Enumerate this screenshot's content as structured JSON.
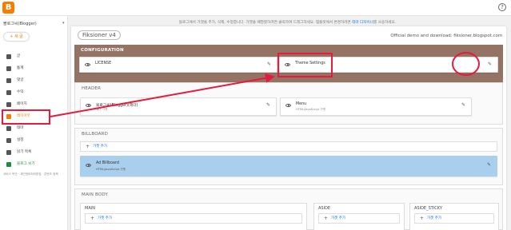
{
  "app": {
    "logo_letter": "B",
    "help_icon": "help-icon"
  },
  "notice": {
    "text": "블로그에서 가젯을 추가, 삭제, 수정합니다. 가젯을 배열할하려면 클릭하여 드래그하세요. 템플릿에서 변경하려면",
    "link": "테마 디자이너",
    "text_after": "를 사용하세요."
  },
  "sidebar": {
    "blog_name": "블로그씨(Blogger)",
    "new_post": "+ 새 글",
    "items": [
      {
        "label": "글",
        "icon": "posts-icon"
      },
      {
        "label": "통계",
        "icon": "stats-icon"
      },
      {
        "label": "댓글",
        "icon": "comments-icon"
      },
      {
        "label": "수익",
        "icon": "earnings-icon"
      },
      {
        "label": "페이지",
        "icon": "pages-icon"
      },
      {
        "label": "레이아웃",
        "icon": "layout-icon"
      },
      {
        "label": "테마",
        "icon": "theme-icon"
      },
      {
        "label": "설정",
        "icon": "settings-icon"
      },
      {
        "label": "읽기 목록",
        "icon": "reading-list-icon"
      },
      {
        "label": "블로그 보기",
        "icon": "view-blog-icon"
      }
    ],
    "footer": "서비스 약관 · 개인정보처리방침 · 콘텐츠 정책"
  },
  "layout": {
    "theme_name": "Fiksioner v4",
    "theme_link": "Official demo and download: fiksioner.blogspot.com",
    "configuration": {
      "title": "CONFIGURATION",
      "gadgets": [
        {
          "label": "LICENSE"
        },
        {
          "label": "Theme Settings"
        }
      ]
    },
    "header": {
      "title": "HEADER",
      "gadgets": [
        {
          "label": "블로그씨(Blogger)(헤더)",
          "sub": "헤더 가젯"
        },
        {
          "label": "Menu",
          "sub": "HTML/JavaScript 가젯"
        }
      ]
    },
    "billboard": {
      "title": "BILLBOARD",
      "add_label": "가젯 추가",
      "gadgets": [
        {
          "label": "Ad Billboard",
          "sub": "HTML/JavaScript 가젯"
        }
      ]
    },
    "main_body": {
      "title": "MAIN BODY",
      "columns": [
        {
          "title": "MAIN",
          "add_label": "가젯 추가"
        },
        {
          "title": "ASIDE",
          "add_label": "가젯 추가"
        },
        {
          "title": "ASIDE_STICKY",
          "add_label": "가젯 추가"
        }
      ]
    }
  },
  "colors": {
    "accent": "#f57d00",
    "config_bg": "#947264",
    "annotation": "#e8193c",
    "selected_gadget": "#a9cfee"
  }
}
